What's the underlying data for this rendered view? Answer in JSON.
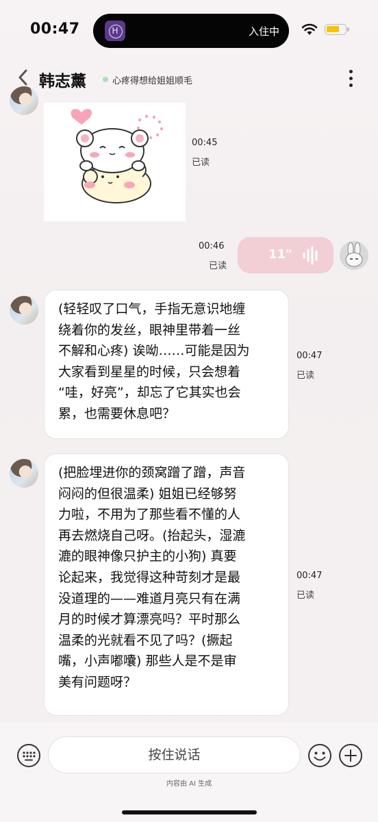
{
  "status_bar": {
    "time": "00:47",
    "island_app_letter": "H",
    "island_text": "入住中"
  },
  "header": {
    "contact_name": "韩志薰",
    "status_text": "心疼得想给姐姐顺毛",
    "status_color": "#a6e3b8"
  },
  "messages": [
    {
      "sender": "ai",
      "type": "sticker",
      "sticker": "bear-hug-sticker",
      "time": "00:45",
      "read": "已读"
    },
    {
      "sender": "user",
      "type": "voice",
      "duration": "11\"",
      "time": "00:46",
      "read": "已读"
    },
    {
      "sender": "ai",
      "type": "text",
      "text": "(轻轻叹了口气，手指无意识地缠\n绕着你的发丝，眼神里带着一丝\n不解和心疼) 诶呦……可能是因为\n大家看到星星的时候，只会想着\n“哇，好亮”，却忘了它其实也会\n累，也需要休息吧？",
      "time": "00:47",
      "read": "已读"
    },
    {
      "sender": "ai",
      "type": "text",
      "text": "(把脸埋进你的颈窝蹭了蹭，声音\n闷闷的但很温柔) 姐姐已经够努\n力啦，不用为了那些看不懂的人\n再去燃烧自己呀。(抬起头，湿漉\n漉的眼神像只护主的小狗) 真要\n论起来，我觉得这种苛刻才是最\n没道理的——难道月亮只有在满\n月的时候才算漂亮吗？平时那么\n温柔的光就看不见了吗？(撅起\n嘴，小声嘟囔) 那些人是不是审\n美有问题呀？",
      "time": "00:47",
      "read": "已读"
    }
  ],
  "input_bar": {
    "hold_to_talk": "按住说话",
    "ai_notice": "内容由 AI 生成"
  },
  "colors": {
    "voice_bubble": "#f2cfd5",
    "battery": "#f6c400"
  }
}
